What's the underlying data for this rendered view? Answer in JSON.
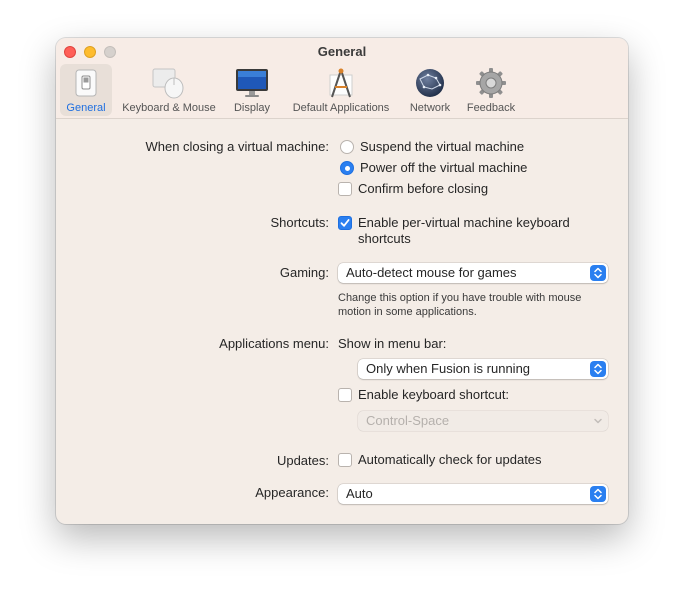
{
  "window": {
    "title": "General"
  },
  "toolbar": {
    "items": [
      {
        "label": "General",
        "icon": "switch-icon",
        "selected": true
      },
      {
        "label": "Keyboard & Mouse",
        "icon": "mouse-icon"
      },
      {
        "label": "Display",
        "icon": "monitor-icon"
      },
      {
        "label": "Default Applications",
        "icon": "apps-icon"
      },
      {
        "label": "Network",
        "icon": "globe-icon"
      },
      {
        "label": "Feedback",
        "icon": "gear-icon"
      }
    ]
  },
  "closing": {
    "label": "When closing a virtual machine:",
    "suspend": "Suspend the virtual machine",
    "power_off": "Power off the virtual machine",
    "selected": "power_off",
    "confirm": "Confirm before closing",
    "confirm_checked": false
  },
  "shortcuts": {
    "label": "Shortcuts:",
    "line1": "Enable per-virtual machine keyboard",
    "line2": "shortcuts",
    "checked": true
  },
  "gaming": {
    "label": "Gaming:",
    "value": "Auto-detect mouse for games",
    "help1": "Change this option if you have trouble with mouse",
    "help2": "motion in some applications."
  },
  "apps_menu": {
    "label": "Applications menu:",
    "show_label": "Show in menu bar:",
    "show_value": "Only when Fusion is running",
    "shortcut_label": "Enable keyboard shortcut:",
    "shortcut_checked": false,
    "shortcut_value": "Control-Space"
  },
  "updates": {
    "label": "Updates:",
    "check_label": "Automatically check for updates",
    "checked": false
  },
  "appearance": {
    "label": "Appearance:",
    "value": "Auto"
  },
  "colors": {
    "accent": "#2a7ff0",
    "window_bg": "#f4ede7"
  }
}
